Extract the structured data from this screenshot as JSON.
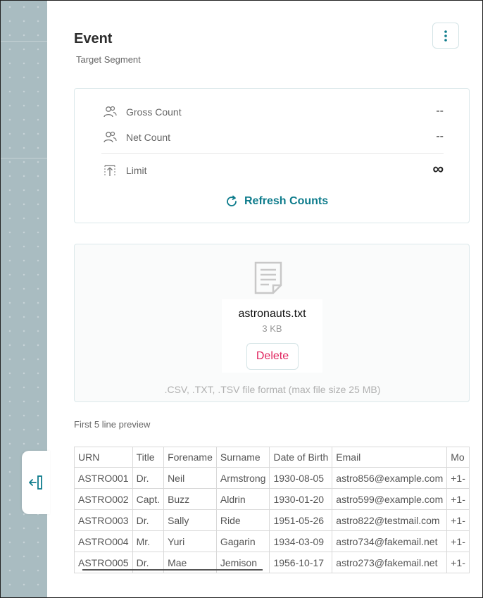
{
  "header": {
    "title": "Event",
    "subtitle": "Target Segment"
  },
  "counts": {
    "gross": {
      "label": "Gross Count",
      "value": "--",
      "icon": "users-icon"
    },
    "net": {
      "label": "Net Count",
      "value": "--",
      "icon": "users-icon"
    },
    "limit": {
      "label": "Limit",
      "value": "∞",
      "icon": "limit-icon"
    },
    "refresh_label": "Refresh Counts"
  },
  "upload": {
    "file_name": "astronauts.txt",
    "file_size": "3 KB",
    "delete_label": "Delete",
    "format_note": ".CSV, .TXT, .TSV file format (max file size 25 MB)"
  },
  "preview": {
    "label": "First 5 line preview",
    "columns": [
      "URN",
      "Title",
      "Forename",
      "Surname",
      "Date of Birth",
      "Email",
      "Mo"
    ],
    "rows": [
      [
        "ASTRO001",
        "Dr.",
        "Neil",
        "Armstrong",
        "1930-08-05",
        "astro856@example.com",
        "+1-"
      ],
      [
        "ASTRO002",
        "Capt.",
        "Buzz",
        "Aldrin",
        "1930-01-20",
        "astro599@example.com",
        "+1-"
      ],
      [
        "ASTRO003",
        "Dr.",
        "Sally",
        "Ride",
        "1951-05-26",
        "astro822@testmail.com",
        "+1-"
      ],
      [
        "ASTRO004",
        "Mr.",
        "Yuri",
        "Gagarin",
        "1934-03-09",
        "astro734@fakemail.net",
        "+1-"
      ],
      [
        "ASTRO005",
        "Dr.",
        "Mae",
        "Jemison",
        "1956-10-17",
        "astro273@fakemail.net",
        "+1-"
      ]
    ]
  },
  "colors": {
    "accent": "#0e7c8c",
    "danger": "#e0245e",
    "sidebar": "#a9bcc1"
  }
}
